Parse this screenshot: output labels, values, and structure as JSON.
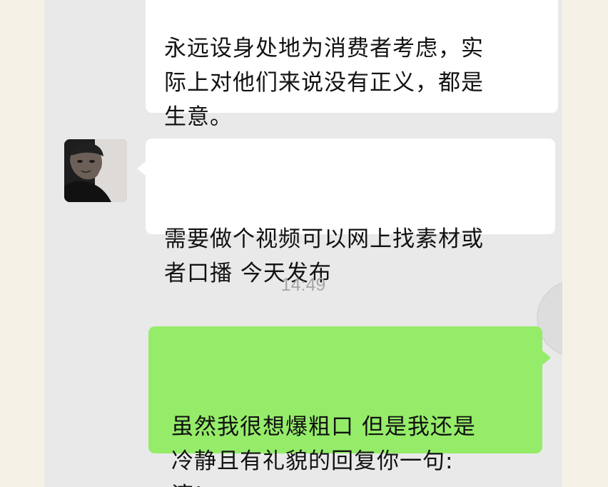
{
  "chat": {
    "messages": [
      {
        "sender": "contact",
        "text": "永远设身处地为消费者考虑，实\n际上对他们来说没有正义，都是\n生意。"
      },
      {
        "sender": "contact",
        "text": "需要做个视频可以网上找素材或\n者口播 今天发布"
      },
      {
        "sender": "me",
        "text": "虽然我很想爆粗口 但是我还是\n冷静且有礼貌的回复你一句:\n滚!"
      }
    ],
    "timestamp": "14:49"
  },
  "colors": {
    "chat_background": "#e9e9e9",
    "incoming_bubble": "#ffffff",
    "outgoing_bubble": "#95ec69",
    "timestamp_text": "#a6a6a6"
  },
  "icons": {
    "contact_avatar": "person-photo"
  }
}
